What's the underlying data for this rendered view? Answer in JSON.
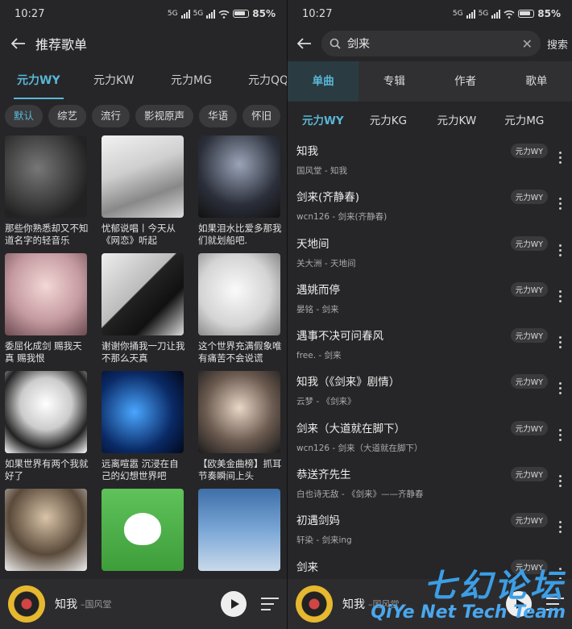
{
  "status": {
    "time": "10:27",
    "network": "5G",
    "battery": "85%"
  },
  "left": {
    "title": "推荐歌单",
    "tabs": [
      "元力WY",
      "元力KW",
      "元力MG",
      "元力QQ"
    ],
    "chips": [
      "默认",
      "综艺",
      "流行",
      "影视原声",
      "华语",
      "怀旧"
    ],
    "playlists": [
      "那些你熟悉却又不知道名字的轻音乐",
      "忧郁说唱丨今天从《网恋》听起",
      "如果泪水比爱多那我们就划船吧.",
      "委屈化成剑 赐我天真 赐我恨",
      "谢谢你捅我一刀让我不那么天真",
      "这个世界充满假象唯有痛苦不会说谎",
      "如果世界有两个我就好了",
      "远离喧嚣 沉浸在自己的幻想世界吧",
      "【欧美金曲榜】抓耳节奏瞬间上头",
      "",
      "",
      ""
    ]
  },
  "right": {
    "search": {
      "value": "剑来",
      "button": "搜索"
    },
    "type_tabs": [
      "单曲",
      "专辑",
      "作者",
      "歌单"
    ],
    "source_tabs": [
      "元力WY",
      "元力KG",
      "元力KW",
      "元力MG"
    ],
    "songs": [
      {
        "title": "知我",
        "sub": "国风堂 - 知我",
        "tag": "元力WY"
      },
      {
        "title": "剑来(齐静春)",
        "sub": "wcn126 - 剑来(齐静春)",
        "tag": "元力WY"
      },
      {
        "title": "天地间",
        "sub": "关大洲 - 天地间",
        "tag": "元力WY"
      },
      {
        "title": "遇姚而停",
        "sub": "晏铭 - 剑来",
        "tag": "元力WY"
      },
      {
        "title": "遇事不决可问春风",
        "sub": "free. - 剑来",
        "tag": "元力WY"
      },
      {
        "title": "知我（《剑来》剧情）",
        "sub": "云梦 - 《剑来》",
        "tag": "元力WY"
      },
      {
        "title": "剑来（大道就在脚下）",
        "sub": "wcn126 - 剑来（大道就在脚下）",
        "tag": "元力WY"
      },
      {
        "title": "恭送齐先生",
        "sub": "白也诗无敌 - 《剑来》——齐静春",
        "tag": "元力WY"
      },
      {
        "title": "初遇剑妈",
        "sub": "轩染 - 剑来ing",
        "tag": "元力WY"
      },
      {
        "title": "剑来",
        "sub": "",
        "tag": "元力WY"
      }
    ]
  },
  "player": {
    "title": "知我",
    "artist": "–国风堂",
    "artist_right": "–国风堂"
  },
  "watermark": {
    "cn": "七幻论坛",
    "en": "QiYe Net Tech Team"
  }
}
